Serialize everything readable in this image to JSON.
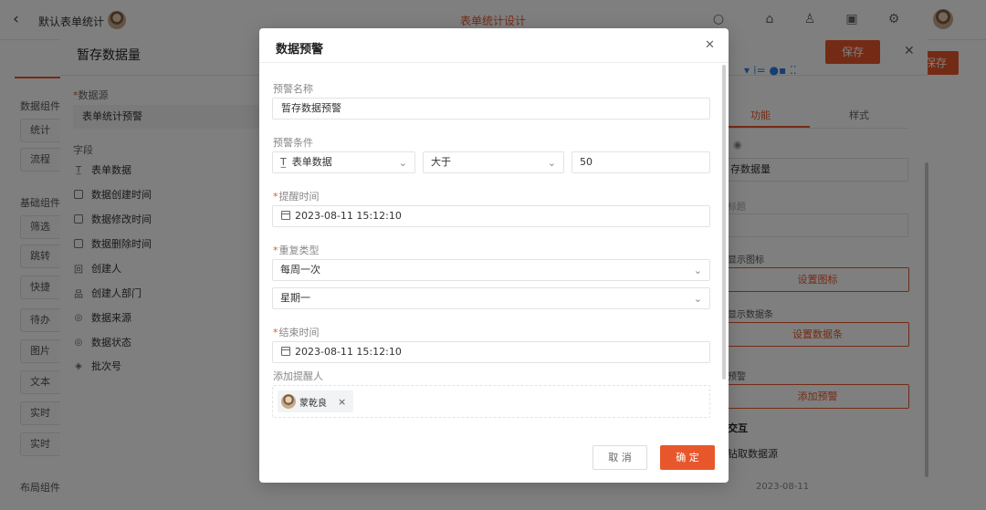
{
  "app": {
    "back_icon": "chevron-left-icon",
    "title": "默认表单统计",
    "center_title": "表单统计设计",
    "save_label": "保存",
    "accent": "#e8572b"
  },
  "left_panel": {
    "sections": [
      "数据组件",
      "基础组件",
      "布局组件"
    ],
    "items": [
      "统计",
      "流程",
      "筛选",
      "跳转",
      "快捷",
      "待办",
      "图片",
      "文本",
      "实时",
      "实时"
    ]
  },
  "drawer": {
    "title": "暂存数据量",
    "save_label": "保存",
    "datasource_label": "数据源",
    "datasource_value": "表单统计预警",
    "fields_label": "字段",
    "fields": [
      {
        "icon": "text-icon",
        "label": "表单数据"
      },
      {
        "icon": "calendar-icon",
        "label": "数据创建时间"
      },
      {
        "icon": "calendar-icon",
        "label": "数据修改时间"
      },
      {
        "icon": "calendar-icon",
        "label": "数据删除时间"
      },
      {
        "icon": "user-icon",
        "label": "创建人"
      },
      {
        "icon": "org-icon",
        "label": "创建人部门"
      },
      {
        "icon": "circle-icon",
        "label": "数据来源"
      },
      {
        "icon": "circle-icon",
        "label": "数据状态"
      },
      {
        "icon": "layers-icon",
        "label": "批次号"
      }
    ],
    "right": {
      "tabs": [
        "功能",
        "样式"
      ],
      "active_tab": "功能",
      "title_value": "存数据量",
      "subtitle_label": "标题",
      "icon_label": "显示图标",
      "icon_button": "设置图标",
      "bar_label": "显示数据条",
      "bar_button": "设置数据条",
      "warn_label": "预警",
      "warn_button": "添加预警",
      "interaction_label": "交互",
      "fetch_label": "钻取数据源",
      "footer_date": "2023-08-11"
    }
  },
  "modal": {
    "title": "数据预警",
    "close_icon": "close-icon",
    "name_label": "预警名称",
    "name_value": "暂存数据预警",
    "condition_label": "预警条件",
    "condition_field": "表单数据",
    "condition_op": "大于",
    "condition_value": "50",
    "remind_label": "提醒时间",
    "remind_value": "2023-08-11 15:12:10",
    "repeat_label": "重复类型",
    "repeat_value": "每周一次",
    "repeat_day": "星期一",
    "end_label": "结束时间",
    "end_value": "2023-08-11 15:12:10",
    "assignee_label": "添加提醒人",
    "assignee_name": "蒙乾良",
    "cancel_label": "取 消",
    "ok_label": "确 定"
  }
}
